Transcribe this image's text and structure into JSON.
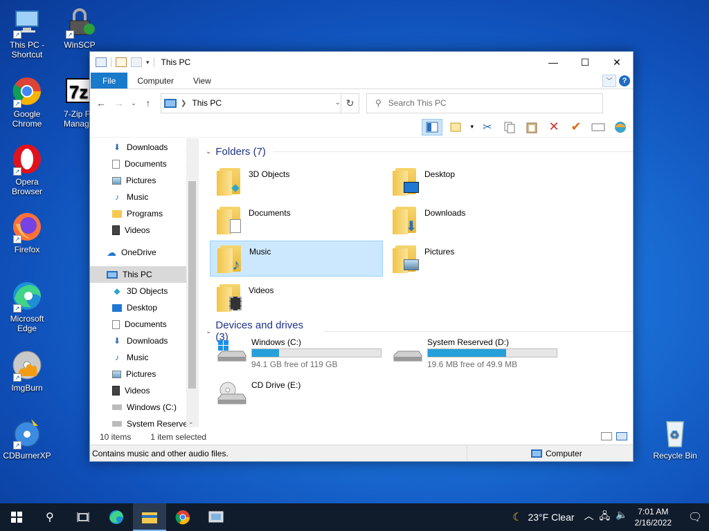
{
  "desktop": {
    "icons": [
      {
        "label": "This PC - Shortcut"
      },
      {
        "label": "WinSCP"
      },
      {
        "label": "Google Chrome"
      },
      {
        "label": "7-Zip F Manag"
      },
      {
        "label": "Opera Browser"
      },
      {
        "label": "Firefox"
      },
      {
        "label": "Microsoft Edge"
      },
      {
        "label": "ImgBurn"
      },
      {
        "label": "CDBurnerXP"
      },
      {
        "label": "Recycle Bin"
      }
    ]
  },
  "window": {
    "title": "This PC",
    "controls": {
      "minimize": "—",
      "maximize": "☐",
      "close": "✕"
    }
  },
  "ribbon": {
    "tabs": [
      "File",
      "Computer",
      "View"
    ],
    "help": "?"
  },
  "navigation": {
    "address": "This PC",
    "search_placeholder": "Search This PC"
  },
  "navpane": {
    "quick_access": [
      {
        "label": "Downloads",
        "icon": "download-arrow-icon",
        "pinned": true
      },
      {
        "label": "Documents",
        "icon": "document-icon",
        "pinned": true
      },
      {
        "label": "Pictures",
        "icon": "picture-icon",
        "pinned": true
      },
      {
        "label": "Music",
        "icon": "music-note-icon",
        "pinned": false
      },
      {
        "label": "Programs",
        "icon": "folder-icon",
        "pinned": false
      },
      {
        "label": "Videos",
        "icon": "film-icon",
        "pinned": false
      }
    ],
    "onedrive": "OneDrive",
    "this_pc": "This PC",
    "this_pc_children": [
      {
        "label": "3D Objects",
        "icon": "cube-icon"
      },
      {
        "label": "Desktop",
        "icon": "desktop-icon"
      },
      {
        "label": "Documents",
        "icon": "document-icon"
      },
      {
        "label": "Downloads",
        "icon": "download-arrow-icon"
      },
      {
        "label": "Music",
        "icon": "music-note-icon"
      },
      {
        "label": "Pictures",
        "icon": "picture-icon"
      },
      {
        "label": "Videos",
        "icon": "film-icon"
      },
      {
        "label": "Windows (C:)",
        "icon": "windows-drive-icon"
      },
      {
        "label": "System Reservec",
        "icon": "drive-icon"
      }
    ]
  },
  "main": {
    "folders_header": "Folders (7)",
    "folders": [
      {
        "label": "3D Objects",
        "badge": "cube-icon",
        "selected": false
      },
      {
        "label": "Desktop",
        "badge": "desktop-icon",
        "selected": false
      },
      {
        "label": "Documents",
        "badge": "document-icon",
        "selected": false
      },
      {
        "label": "Downloads",
        "badge": "download-arrow-icon",
        "selected": false
      },
      {
        "label": "Music",
        "badge": "music-note-icon",
        "selected": true
      },
      {
        "label": "Pictures",
        "badge": "picture-icon",
        "selected": false
      },
      {
        "label": "Videos",
        "badge": "film-icon",
        "selected": false
      }
    ],
    "drives_header": "Devices and drives (3)",
    "drives": [
      {
        "name": "Windows (C:)",
        "free": "94.1 GB free of 119 GB",
        "used_fraction": 0.21,
        "icon": "windows-drive-icon"
      },
      {
        "name": "System Reserved (D:)",
        "free": "19.6 MB free of 49.9 MB",
        "used_fraction": 0.61,
        "icon": "drive-icon"
      },
      {
        "name": "CD Drive (E:)",
        "free": "",
        "used_fraction": null,
        "icon": "cd-drive-icon"
      }
    ]
  },
  "status": {
    "item_count": "10 items",
    "selected": "1 item selected",
    "description": "Contains music and other audio files.",
    "location": "Computer"
  },
  "taskbar": {
    "weather": "23°F  Clear",
    "time": "7:01 AM",
    "date": "2/16/2022"
  },
  "colors": {
    "accent": "#1979ca",
    "selection": "#cce8ff",
    "drive_bar": "#26a0da",
    "group_header": "#1e3287"
  }
}
